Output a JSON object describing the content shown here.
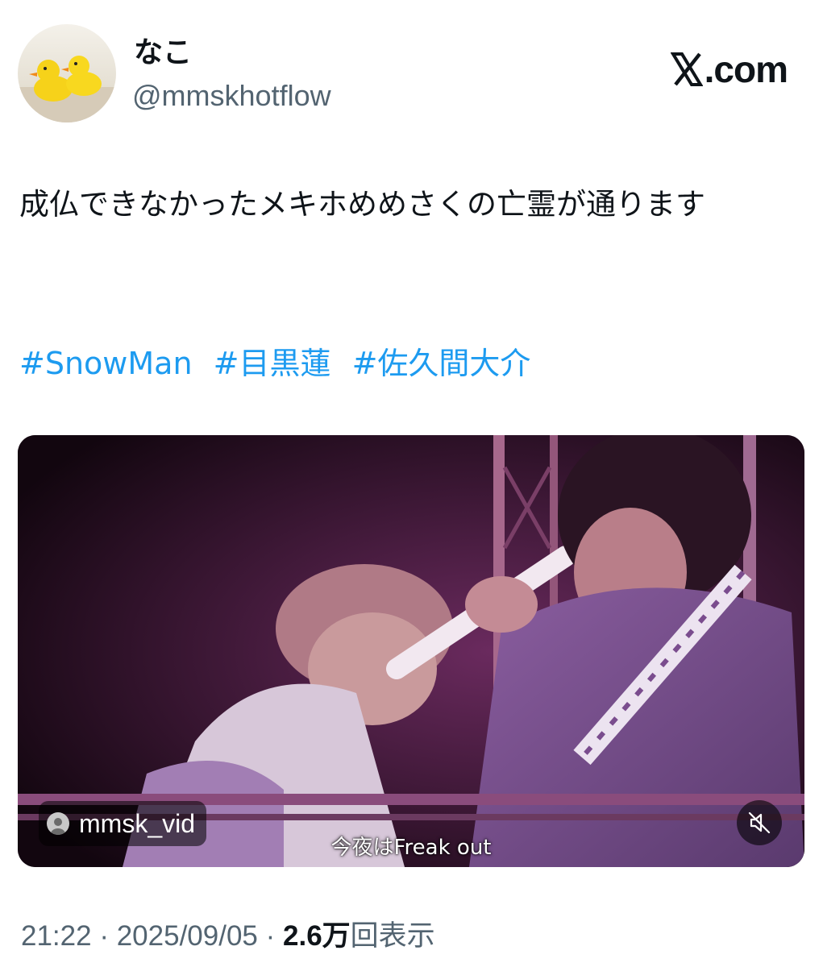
{
  "author": {
    "display_name": "なこ",
    "handle": "@mmskhotflow"
  },
  "brand": {
    "label": ".com",
    "x_icon": "x-logo-icon"
  },
  "tweet": {
    "text": "成仏できなかったメキホめめさくの亡霊が通ります",
    "hashtags": [
      "#SnowMan",
      "#目黒蓮",
      "#佐久間大介"
    ]
  },
  "media": {
    "account_tag": "mmsk_vid",
    "subtitle": "今夜はFreak out",
    "mute_icon": "speaker-muted-icon"
  },
  "meta": {
    "time": "21:22",
    "separator": "·",
    "date": "2025/09/05",
    "views_count": "2.6万",
    "views_label": "回表示"
  },
  "colors": {
    "link": "#1d9bf0",
    "secondary_text": "#536471",
    "primary_text": "#0f1419"
  }
}
